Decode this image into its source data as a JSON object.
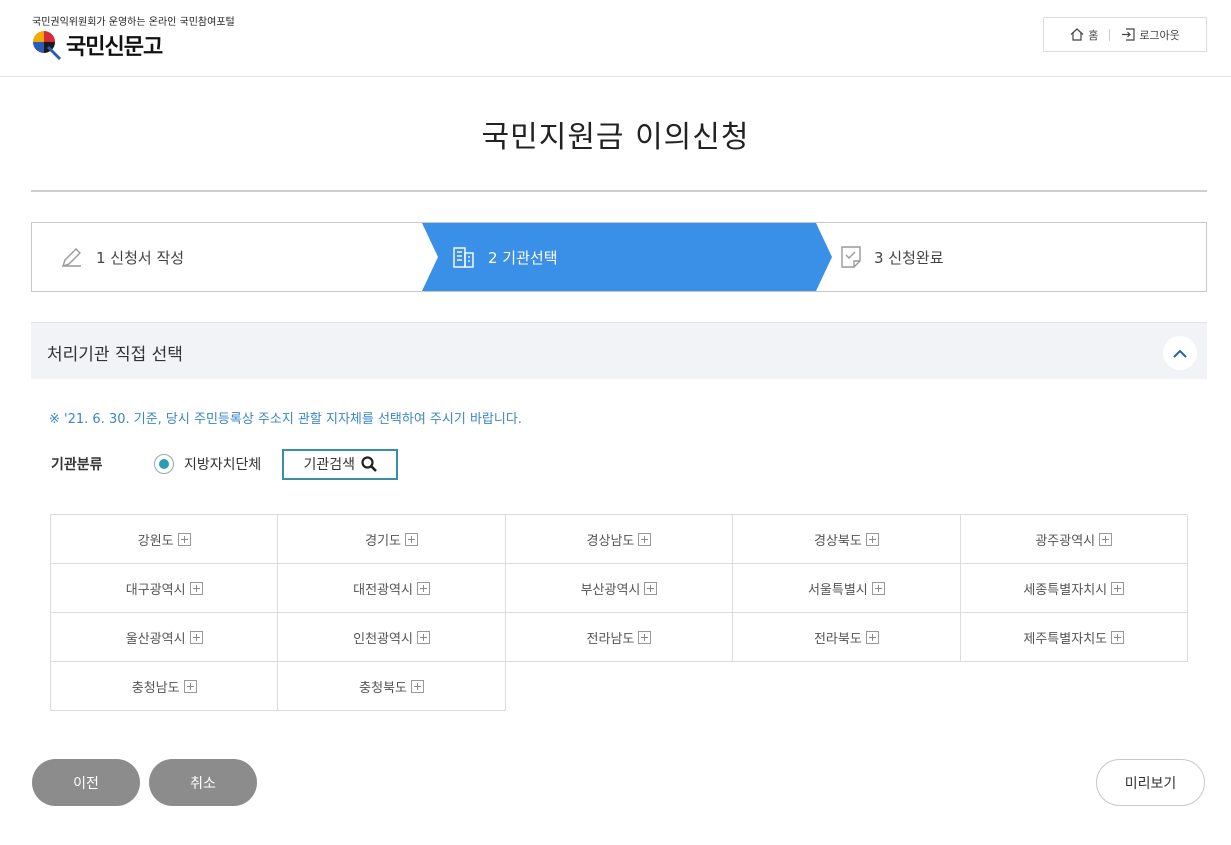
{
  "header": {
    "tagline": "국민권익위원회가 운영하는 온라인 국민참여포털",
    "logo_text": "국민신문고",
    "home_label": "홈",
    "logout_label": "로그아웃"
  },
  "page_title": "국민지원금 이의신청",
  "steps": [
    {
      "label": "1 신청서 작성",
      "icon": "pencil-icon",
      "active": false
    },
    {
      "label": "2 기관선택",
      "icon": "building-icon",
      "active": true
    },
    {
      "label": "3 신청완료",
      "icon": "document-check-icon",
      "active": false
    }
  ],
  "section": {
    "title": "처리기관 직접 선택",
    "toggle_icon": "chevron-up-icon"
  },
  "notice": "※ '21. 6. 30. 기준, 당시 주민등록상 주소지 관할 지자체를 선택하여 주시기 바랍니다.",
  "filter": {
    "label": "기관분류",
    "radio_label": "지방자치단체",
    "search_label": "기관검색"
  },
  "regions": [
    "강원도",
    "경기도",
    "경상남도",
    "경상북도",
    "광주광역시",
    "대구광역시",
    "대전광역시",
    "부산광역시",
    "서울특별시",
    "세종특별자치시",
    "울산광역시",
    "인천광역시",
    "전라남도",
    "전라북도",
    "제주특별자치도",
    "충청남도",
    "충청북도"
  ],
  "buttons": {
    "prev": "이전",
    "cancel": "취소",
    "preview": "미리보기"
  },
  "colors": {
    "active_step": "#3a8fe6",
    "notice": "#3a86c8",
    "radio": "#2e9bb5",
    "gray_button": "#8c8c8c"
  }
}
